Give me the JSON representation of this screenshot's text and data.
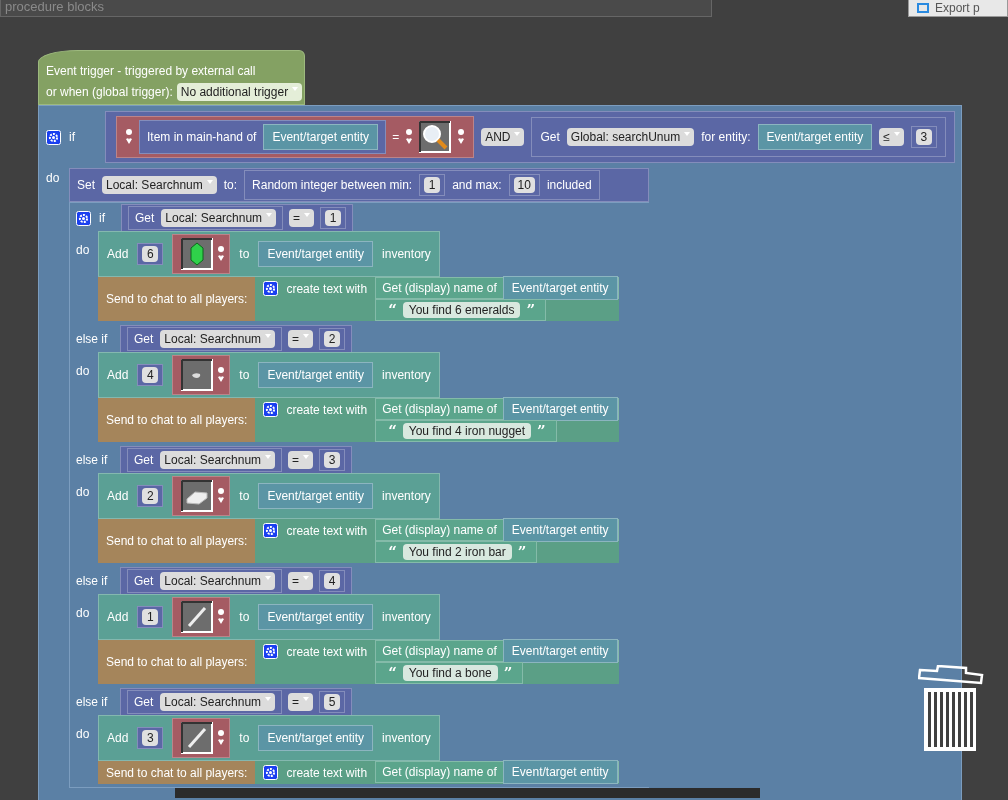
{
  "header": {
    "title": "procedure blocks",
    "export_button": "Export p"
  },
  "trigger": {
    "title": "Event trigger - triggered by external call",
    "label": "or when (global trigger):",
    "dropdown": "No additional trigger"
  },
  "condition": {
    "keyword": "if",
    "item_label": "Item in main-hand of",
    "item_entity": "Event/target entity",
    "equals": "=",
    "kind": "magnifier",
    "logic": "AND",
    "get": "Get",
    "variable": "Global: searchUnum",
    "for_label": "for entity:",
    "entity": "Event/target entity",
    "operator": "≤",
    "value": "3"
  },
  "do_label": "do",
  "set_block": {
    "set": "Set",
    "variable": "Local: Searchnum",
    "to": "to:",
    "random_label": "Random integer between min:",
    "min": "1",
    "and_max": "and max:",
    "max": "10",
    "included": "included"
  },
  "branches": [
    {
      "keyword": "if",
      "get": "Get",
      "variable": "Local: Searchnum",
      "operator": "=",
      "value": "1",
      "do": "do",
      "add": "Add",
      "count": "6",
      "kind": "emerald",
      "to": "to",
      "entity": "Event/target entity",
      "inventory": "inventory",
      "send": "Send to chat to all players:",
      "create": "create text with",
      "name_of": "Get (display) name of",
      "name_entity": "Event/target entity",
      "open_quote": "“",
      "message": "You find 6 emeralds",
      "close_quote": "”"
    },
    {
      "keyword": "else if",
      "get": "Get",
      "variable": "Local: Searchnum",
      "operator": "=",
      "value": "2",
      "do": "do",
      "add": "Add",
      "count": "4",
      "kind": "nugget",
      "to": "to",
      "entity": "Event/target entity",
      "inventory": "inventory",
      "send": "Send to chat to all players:",
      "create": "create text with",
      "name_of": "Get (display) name of",
      "name_entity": "Event/target entity",
      "open_quote": "“",
      "message": "You find 4 iron nugget",
      "close_quote": "”"
    },
    {
      "keyword": "else if",
      "get": "Get",
      "variable": "Local: Searchnum",
      "operator": "=",
      "value": "3",
      "do": "do",
      "add": "Add",
      "count": "2",
      "kind": "bar",
      "to": "to",
      "entity": "Event/target entity",
      "inventory": "inventory",
      "send": "Send to chat to all players:",
      "create": "create text with",
      "name_of": "Get (display) name of",
      "name_entity": "Event/target entity",
      "open_quote": "“",
      "message": "You find 2 iron bar",
      "close_quote": "”"
    },
    {
      "keyword": "else if",
      "get": "Get",
      "variable": "Local: Searchnum",
      "operator": "=",
      "value": "4",
      "do": "do",
      "add": "Add",
      "count": "1",
      "kind": "bone",
      "to": "to",
      "entity": "Event/target entity",
      "inventory": "inventory",
      "send": "Send to chat to all players:",
      "create": "create text with",
      "name_of": "Get (display) name of",
      "name_entity": "Event/target entity",
      "open_quote": "“",
      "message": "You find a bone",
      "close_quote": "”"
    },
    {
      "keyword": "else if",
      "get": "Get",
      "variable": "Local: Searchnum",
      "operator": "=",
      "value": "5",
      "do": "do",
      "add": "Add",
      "count": "3",
      "kind": "bone",
      "to": "to",
      "entity": "Event/target entity",
      "inventory": "inventory",
      "send": "Send to chat to all players:",
      "create": "create text with",
      "name_of": "Get (display) name of",
      "name_entity": "Event/target entity"
    }
  ]
}
